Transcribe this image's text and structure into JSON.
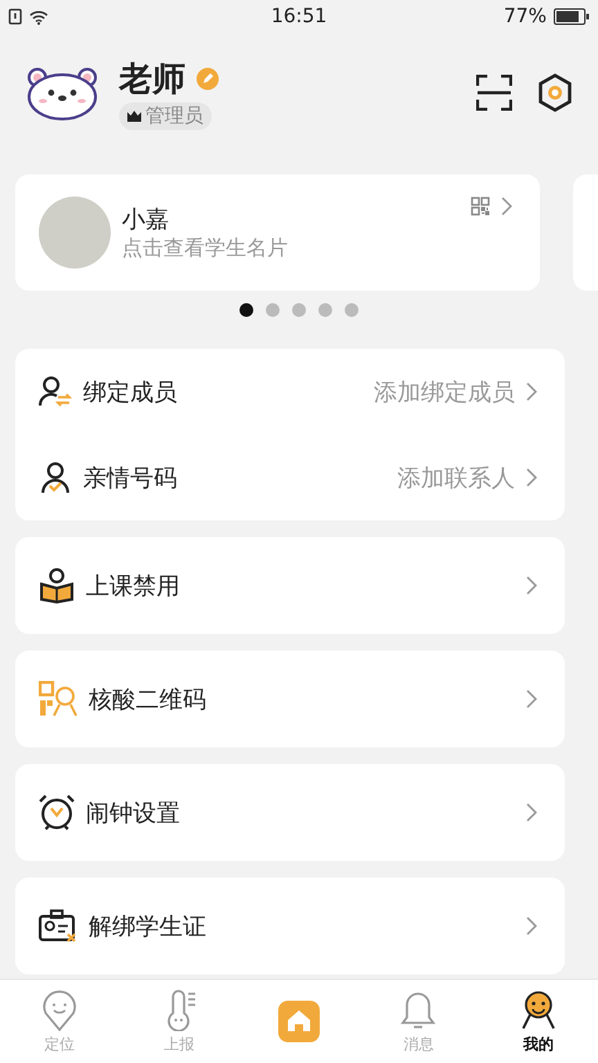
{
  "status_bar": {
    "time": "16:51",
    "battery": "77%"
  },
  "profile": {
    "name": "老师",
    "role": "管理员"
  },
  "student_cards": [
    {
      "name": "小嘉",
      "subtitle": "点击查看学生名片"
    }
  ],
  "pager": [
    {
      "selected": true
    },
    {
      "selected": false
    },
    {
      "selected": false
    },
    {
      "selected": false
    },
    {
      "selected": false
    }
  ],
  "menu_groups": [
    {
      "items": [
        {
          "kind": "bind",
          "label": "绑定成员",
          "hint": "添加绑定成员"
        },
        {
          "kind": "family",
          "label": "亲情号码",
          "hint": "添加联系人"
        }
      ]
    },
    {
      "items": [
        {
          "kind": "class",
          "label": "上课禁用"
        }
      ]
    },
    {
      "items": [
        {
          "kind": "qr",
          "label": "核酸二维码"
        }
      ]
    },
    {
      "items": [
        {
          "kind": "alarm",
          "label": "闹钟设置"
        }
      ]
    },
    {
      "items": [
        {
          "kind": "card",
          "label": "解绑学生证"
        }
      ]
    }
  ],
  "tab_bar": [
    {
      "kind": "location",
      "label": "定位",
      "selected": false
    },
    {
      "kind": "thermo",
      "label": "上报",
      "selected": false
    },
    {
      "kind": "home",
      "selected": false
    },
    {
      "kind": "bell",
      "label": "消息",
      "selected": false
    },
    {
      "kind": "me",
      "label": "我的",
      "selected": true
    }
  ]
}
